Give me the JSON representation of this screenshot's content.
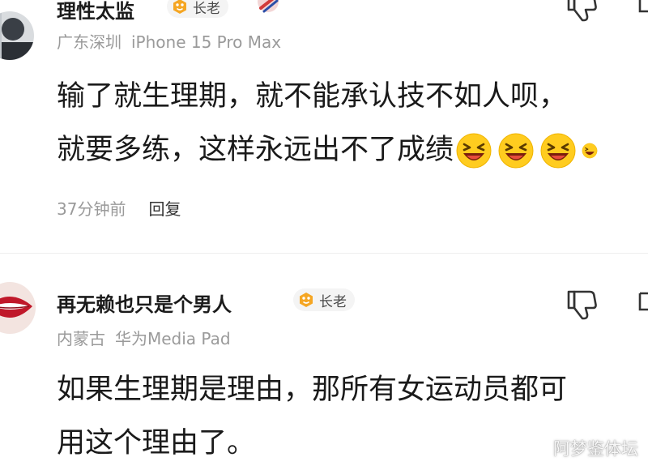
{
  "comments": [
    {
      "username": "理性太监",
      "badge": "长老",
      "location": "广东深圳",
      "device": "iPhone 15 Pro Max",
      "lines": [
        "输了就生理期，就不能承认技不如人呗，",
        "就要多练，这样永远出不了成绩"
      ],
      "emoji": "laughing-emoji",
      "time": "37分钟前",
      "reply": "回复"
    },
    {
      "username": "再无赖也只是个男人",
      "badge": "长老",
      "location": "内蒙古",
      "device": "华为Media Pad",
      "lines": [
        "如果生理期是理由，那所有女运动员都可",
        "用这个理由了。"
      ]
    }
  ],
  "icons": {
    "like": "thumbs-down-icon",
    "badge": "elder-badge-icon"
  },
  "colors": {
    "badge_orange": "#f5a623",
    "meta_gray": "#9a9a9a",
    "emoji_yellow": "#ffcc1f"
  },
  "watermark": "阿梦鉴体坛"
}
